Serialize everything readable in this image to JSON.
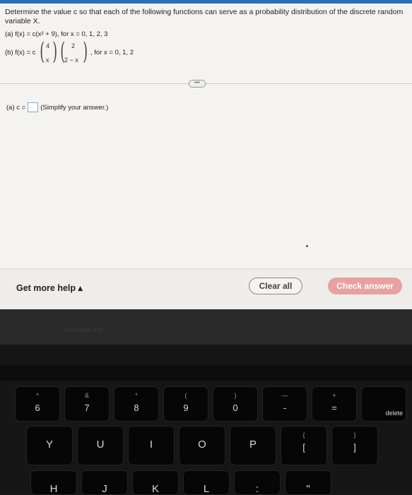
{
  "question": {
    "intro": "Determine the value c so that each of the following functions can serve as a probability distribution of the discrete random variable X.",
    "part_a": "(a) f(x) = c(x² + 9), for x = 0, 1, 2, 3",
    "part_b_prefix": "(b) f(x) = c",
    "binom1_top": "4",
    "binom1_bottom": "x",
    "binom2_top": "2",
    "binom2_bottom": "2 − x",
    "part_b_suffix": ", for x = 0, 1, 2",
    "more_button": "•••"
  },
  "answer": {
    "label": "(a) c =",
    "hint": "(Simplify your answer.)",
    "value": ""
  },
  "footer": {
    "help_label": "Get more help ▴",
    "clear_label": "Clear all",
    "check_label": "Check answer",
    "check_color": "#e7a1a0"
  },
  "laptop": {
    "bezel_label": "MacBook Pro",
    "keys_row1": [
      {
        "top": "^",
        "main": "6"
      },
      {
        "top": "&",
        "main": "7"
      },
      {
        "top": "*",
        "main": "8"
      },
      {
        "top": "(",
        "main": "9"
      },
      {
        "top": ")",
        "main": "0"
      },
      {
        "top": "—",
        "main": "-"
      },
      {
        "top": "+",
        "main": "="
      },
      {
        "top": "",
        "main": "delete"
      }
    ],
    "keys_row2": [
      {
        "main": "Y"
      },
      {
        "main": "U"
      },
      {
        "main": "I"
      },
      {
        "main": "O"
      },
      {
        "main": "P"
      },
      {
        "top": "{",
        "main": "["
      },
      {
        "top": "}",
        "main": "]"
      }
    ],
    "keys_row3": [
      {
        "main": "H"
      },
      {
        "main": "J"
      },
      {
        "main": "K"
      },
      {
        "main": "L"
      },
      {
        "main": ":"
      },
      {
        "main": "\""
      }
    ]
  }
}
